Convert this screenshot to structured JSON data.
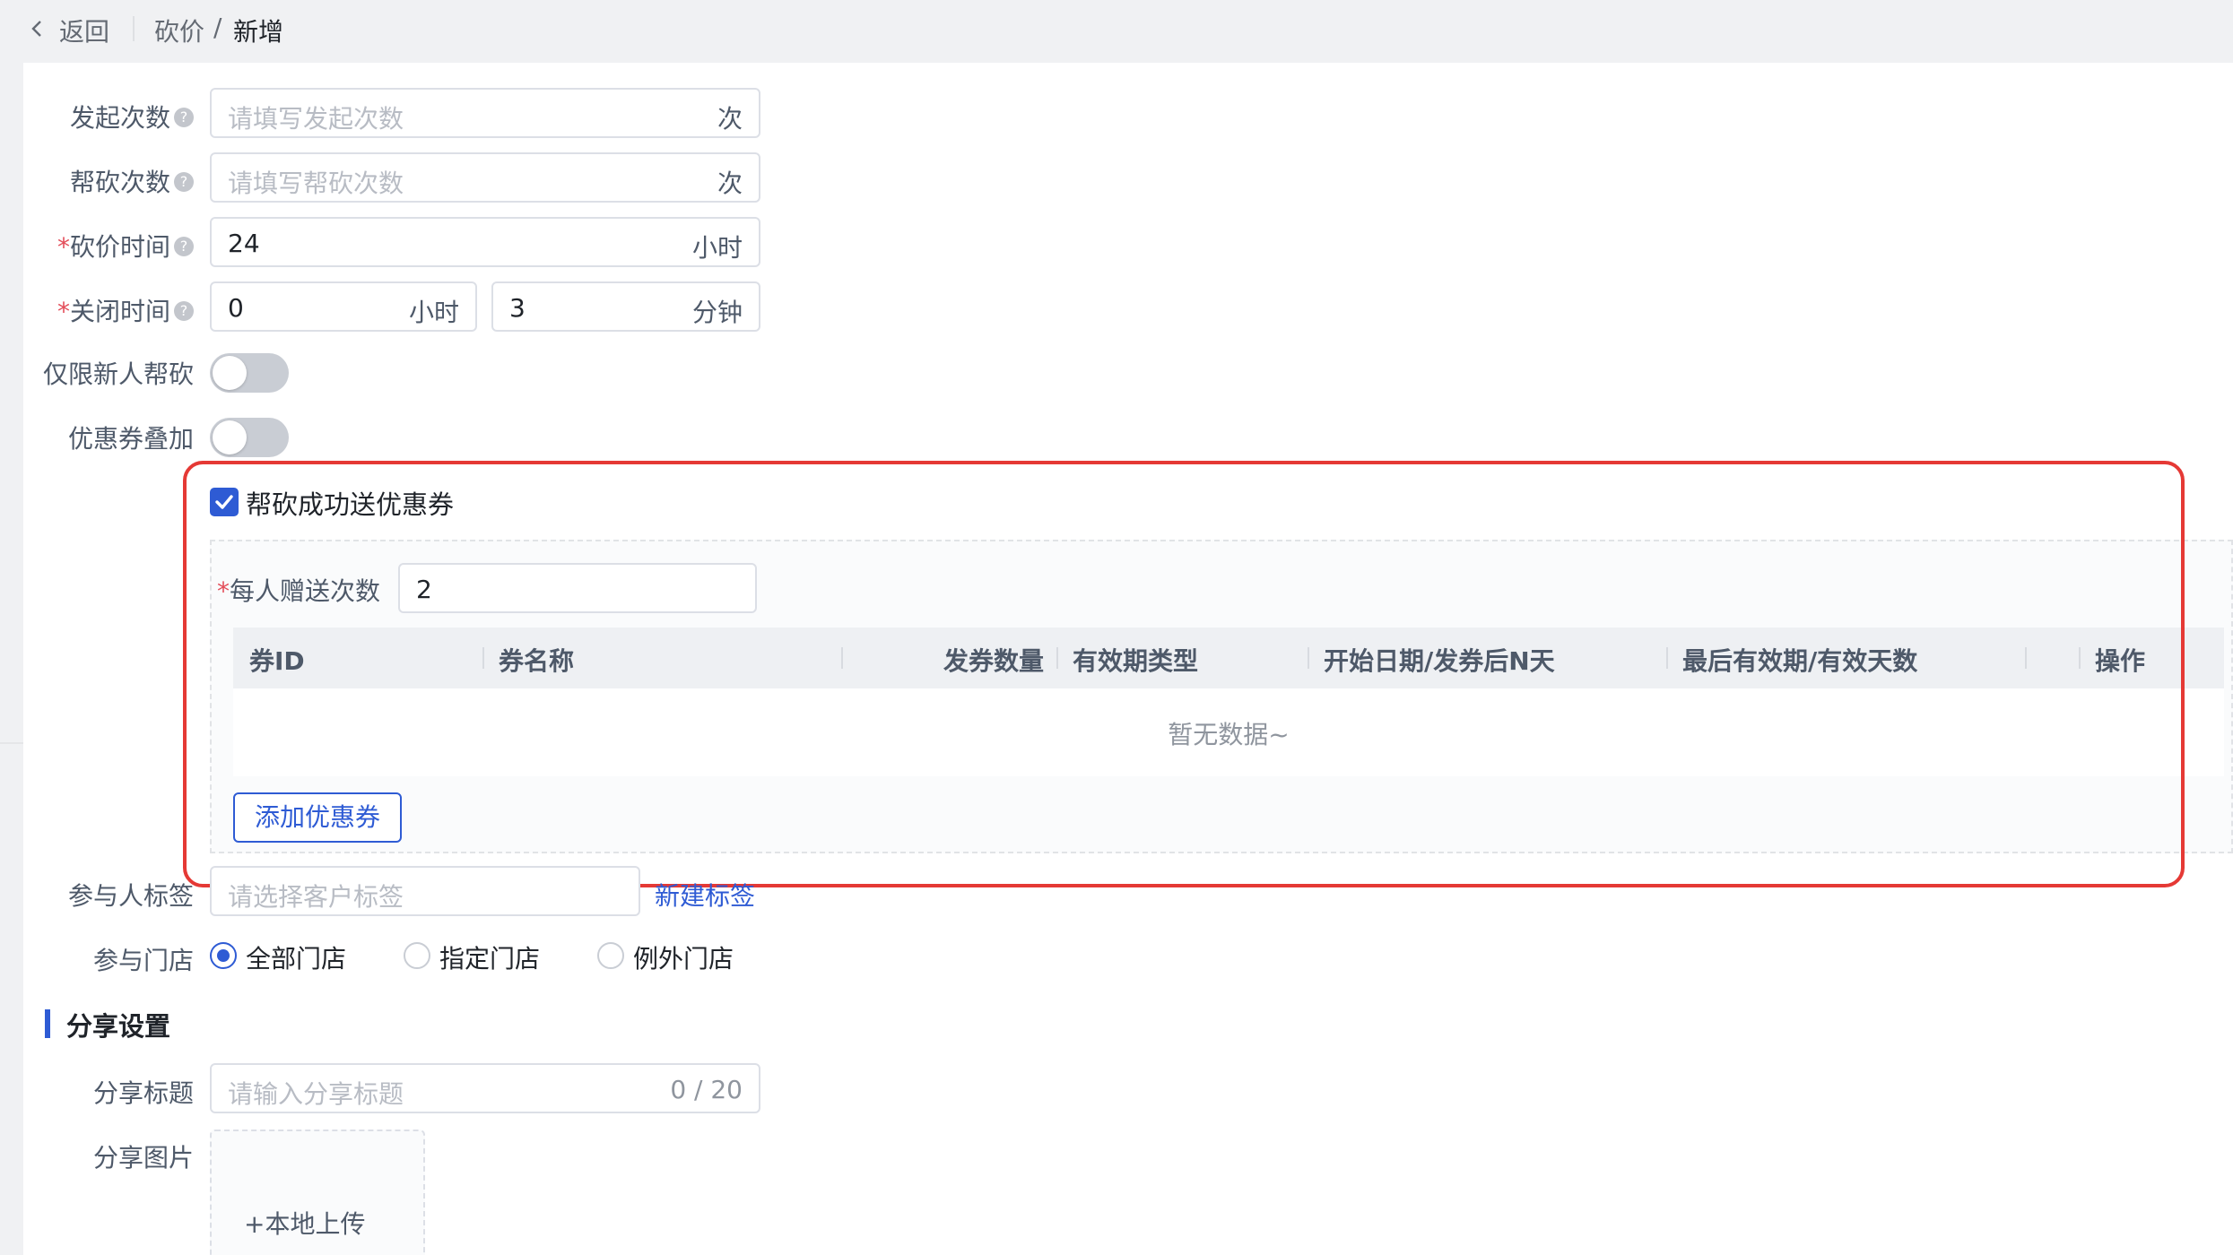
{
  "header": {
    "back_label": "返回",
    "breadcrumb": [
      "砍价",
      "新增"
    ],
    "separator": "/"
  },
  "form": {
    "launch_count": {
      "label": "发起次数",
      "placeholder": "请填写发起次数",
      "suffix": "次"
    },
    "help_count": {
      "label": "帮砍次数",
      "placeholder": "请填写帮砍次数",
      "suffix": "次"
    },
    "bargain_time": {
      "required": "*",
      "label": "砍价时间",
      "value": "24",
      "suffix": "小时"
    },
    "close_time": {
      "required": "*",
      "label": "关闭时间",
      "hours_value": "0",
      "hours_suffix": "小时",
      "minutes_value": "3",
      "minutes_suffix": "分钟"
    },
    "new_user_only": {
      "label": "仅限新人帮砍",
      "on": false
    },
    "coupon_stack": {
      "label": "优惠券叠加",
      "on": false
    },
    "coupon_gift": {
      "checkbox_label": "帮砍成功送优惠券",
      "checked": true,
      "per_person": {
        "required": "*",
        "label": "每人赠送次数",
        "value": "2"
      },
      "table": {
        "columns": [
          "券ID",
          "券名称",
          "发券数量",
          "有效期类型",
          "开始日期/发券后N天",
          "最后有效期/有效天数",
          "操作"
        ],
        "empty_text": "暂无数据~"
      },
      "add_button": "添加优惠券"
    },
    "participant_tags": {
      "label": "参与人标签",
      "placeholder": "请选择客户标签",
      "link": "新建标签"
    },
    "stores": {
      "label": "参与门店",
      "options": [
        "全部门店",
        "指定门店",
        "例外门店"
      ],
      "selected": "全部门店"
    }
  },
  "share": {
    "section_title": "分享设置",
    "title_field": {
      "label": "分享标题",
      "placeholder": "请输入分享标题",
      "counter": "0 / 20"
    },
    "image_field": {
      "label": "分享图片",
      "upload_label": "+本地上传"
    }
  },
  "colors": {
    "accent": "#2e5bd4",
    "required": "#e34d59",
    "highlight_border": "#e53935"
  },
  "icons": [
    "chevron-left-icon",
    "help-circle-icon",
    "check-icon",
    "plus-icon"
  ]
}
